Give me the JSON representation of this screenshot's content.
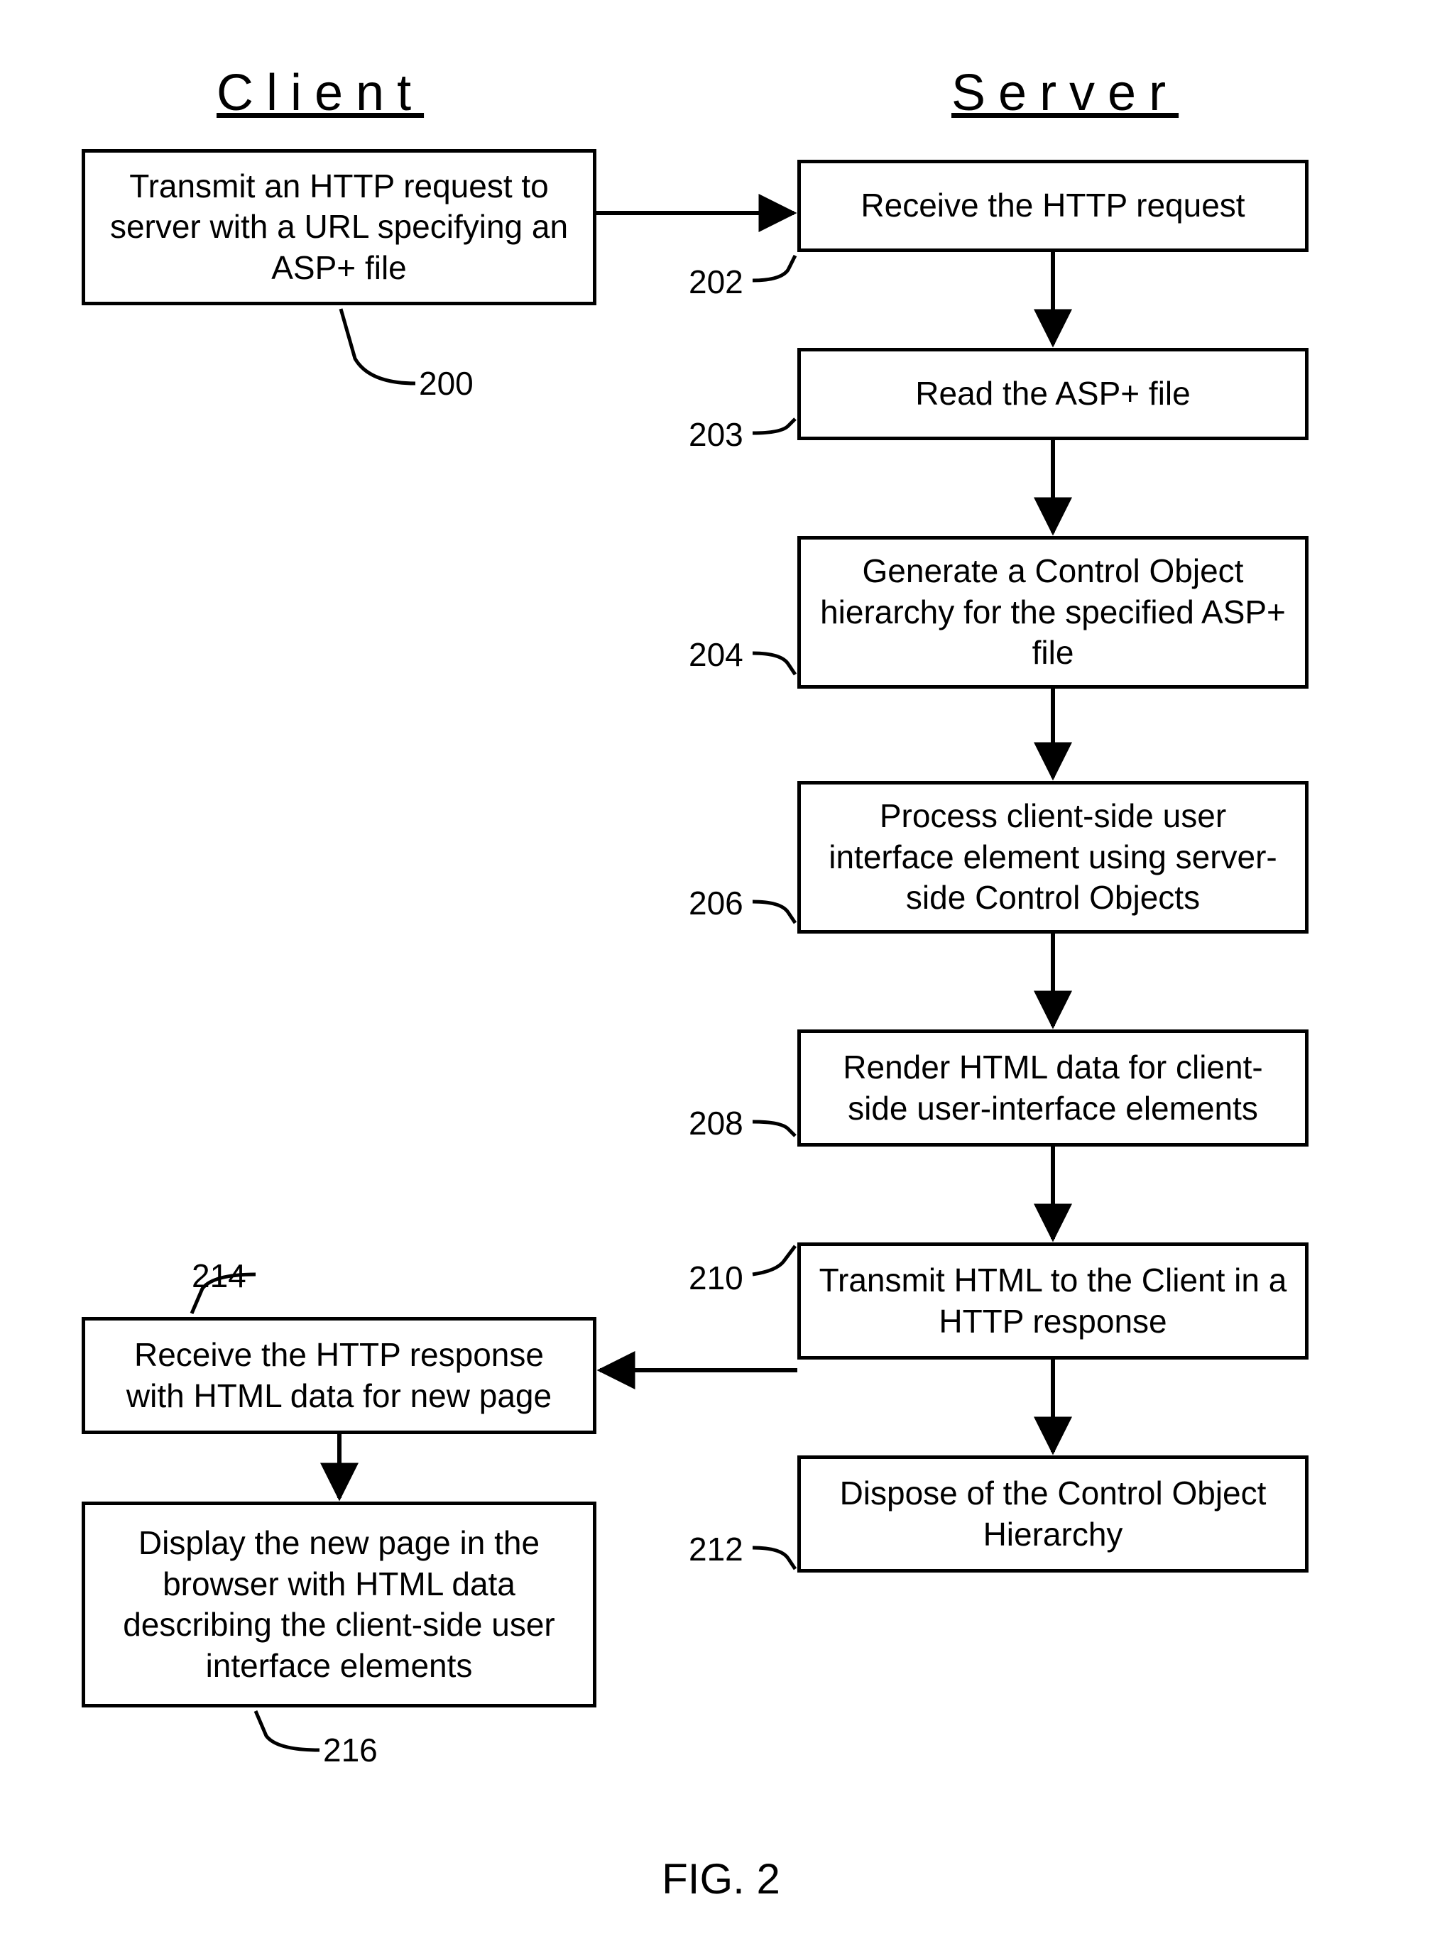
{
  "headers": {
    "client": "Client",
    "server": "Server"
  },
  "boxes": {
    "b200": "Transmit an HTTP request to server with a URL specifying an ASP+ file",
    "b202": "Receive the HTTP request",
    "b203": "Read the ASP+ file",
    "b204": "Generate a Control Object hierarchy for the specified ASP+ file",
    "b206": "Process client-side user interface element using server-side Control Objects",
    "b208": "Render HTML data for client-side user-interface elements",
    "b210": "Transmit HTML to the Client in a HTTP response",
    "b212": "Dispose of the Control Object Hierarchy",
    "b214": "Receive the HTTP response with HTML data for new page",
    "b216": "Display the new page in the browser with HTML data describing the client-side user interface elements"
  },
  "refs": {
    "r200": "200",
    "r202": "202",
    "r203": "203",
    "r204": "204",
    "r206": "206",
    "r208": "208",
    "r210": "210",
    "r212": "212",
    "r214": "214",
    "r216": "216"
  },
  "caption": "FIG. 2"
}
